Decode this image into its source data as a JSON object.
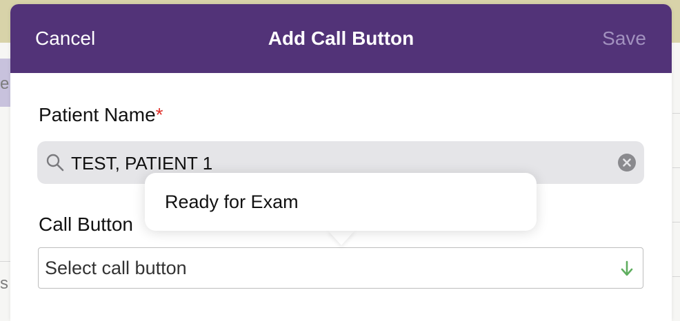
{
  "navbar": {
    "cancel_label": "Cancel",
    "title": "Add Call Button",
    "save_label": "Save"
  },
  "patient": {
    "label": "Patient Name",
    "required_marker": "*",
    "value": "TEST, PATIENT 1"
  },
  "call_button": {
    "label": "Call Button",
    "placeholder": "Select call button"
  },
  "popover": {
    "items": [
      "Ready for Exam"
    ]
  },
  "background": {
    "letter_top": "e",
    "letter_bottom": "s"
  },
  "colors": {
    "navbar": "#523378",
    "save_disabled": "#a291bf",
    "required": "#e0302a",
    "dropdown_arrow": "#5fae5f"
  },
  "icons": {
    "search": "search-icon",
    "clear": "clear-icon",
    "dropdown": "arrow-down-icon"
  }
}
